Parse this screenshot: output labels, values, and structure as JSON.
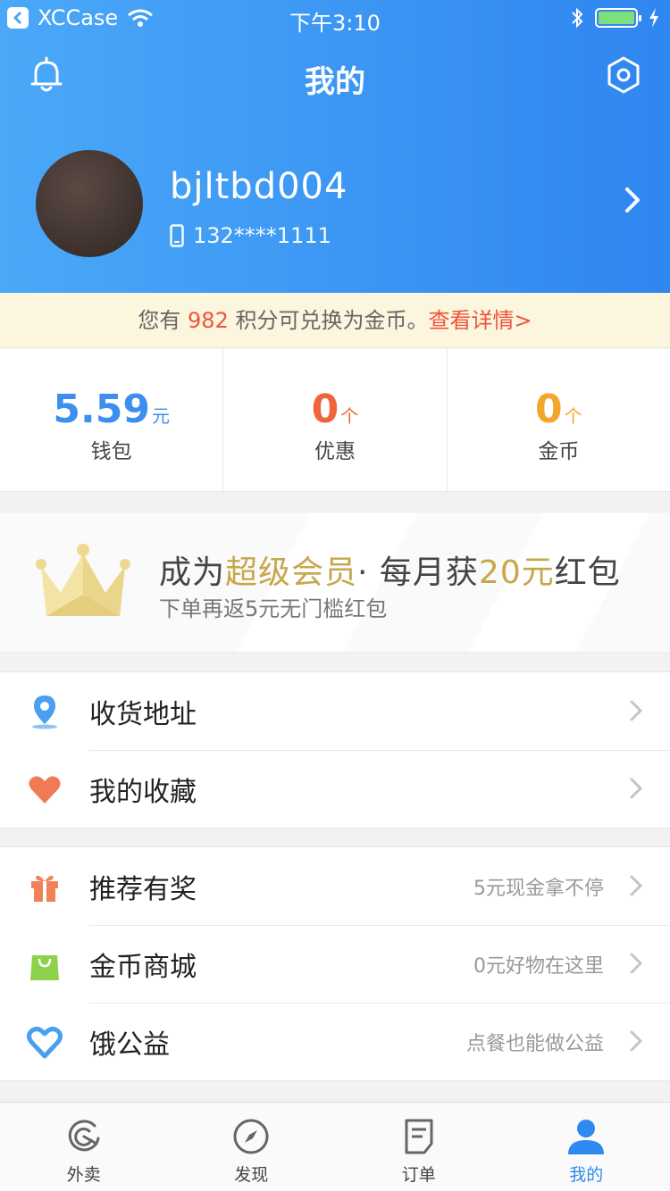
{
  "status_bar": {
    "carrier": "XCCase",
    "time": "下午3:10"
  },
  "nav": {
    "title": "我的"
  },
  "profile": {
    "username": "bjltbd004",
    "phone": "132****1111"
  },
  "points": {
    "prefix": "您有",
    "amount": "982",
    "middle": "积分可兑换为金币。",
    "link": "查看详情>"
  },
  "stats": [
    {
      "value": "5.59",
      "unit": "元",
      "label": "钱包",
      "color": "#3e8eee"
    },
    {
      "value": "0",
      "unit": "个",
      "label": "优惠",
      "color": "#f0643a"
    },
    {
      "value": "0",
      "unit": "个",
      "label": "金币",
      "color": "#f2a62a"
    }
  ],
  "vip": {
    "title_part1": "成为",
    "title_gold1": "超级会员",
    "title_part2": "· 每月获",
    "title_gold2": "20元",
    "title_part3": "红包",
    "subtitle": "下单再返5元无门槛红包"
  },
  "list1": [
    {
      "label": "收货地址",
      "icon": "location-icon"
    },
    {
      "label": "我的收藏",
      "icon": "heart-icon"
    }
  ],
  "list2": [
    {
      "label": "推荐有奖",
      "hint": "5元现金拿不停",
      "icon": "gift-icon"
    },
    {
      "label": "金币商城",
      "hint": "0元好物在这里",
      "icon": "shopping-bag-icon"
    },
    {
      "label": "饿公益",
      "hint": "点餐也能做公益",
      "icon": "charity-heart-icon"
    }
  ],
  "tabs": [
    {
      "label": "外卖",
      "icon": "takeout-icon"
    },
    {
      "label": "发现",
      "icon": "compass-icon"
    },
    {
      "label": "订单",
      "icon": "order-icon"
    },
    {
      "label": "我的",
      "icon": "profile-icon",
      "active": true
    }
  ],
  "colors": {
    "primary": "#2f86ef",
    "accent_red": "#f0543a",
    "gold": "#c7a74a"
  }
}
